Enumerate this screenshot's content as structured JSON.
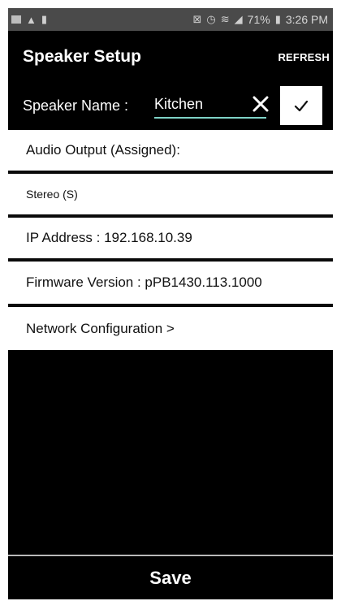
{
  "status_bar": {
    "left_icons": [
      "photo-icon",
      "warning-icon",
      "battery-saver-icon"
    ],
    "right_icons": [
      "nfc-icon",
      "alarm-icon",
      "wifi-icon",
      "signal-icon"
    ],
    "battery": "71%",
    "time": "3:26 PM"
  },
  "header": {
    "title": "Speaker Setup",
    "refresh_label": "REFRESH",
    "name_label": "Speaker Name :",
    "name_value": "Kitchen"
  },
  "rows": {
    "audio_output": "Audio Output (Assigned):",
    "audio_value": "Stereo (S)",
    "ip_address": "IP  Address : 192.168.10.39",
    "firmware": "Firmware  Version : pPB1430.113.1000",
    "network": "Network  Configuration >"
  },
  "footer": {
    "save_label": "Save"
  },
  "colors": {
    "background": "#000000",
    "surface": "#ffffff",
    "input_underline": "#7fd3c7",
    "status_bar": "#4a4a4a"
  }
}
